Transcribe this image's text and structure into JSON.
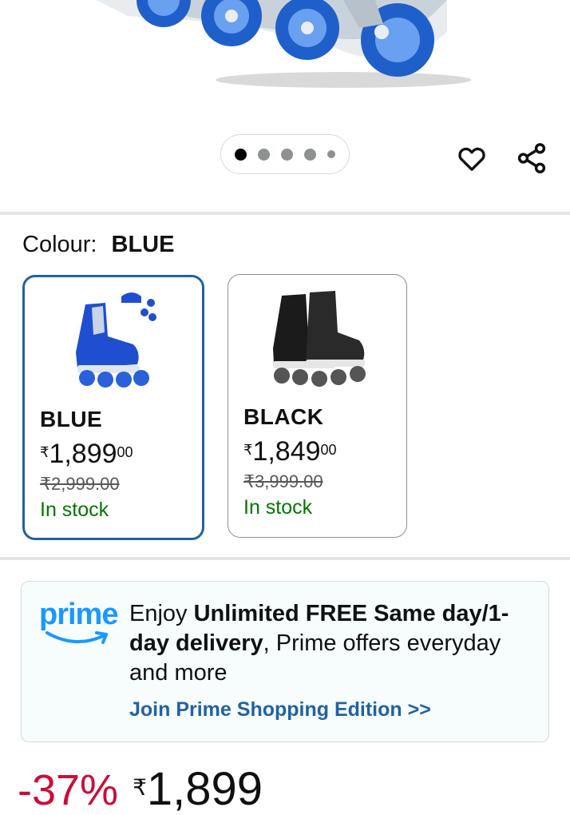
{
  "gallery": {
    "dot_count": 5,
    "active_index": 0
  },
  "icons": {
    "wishlist": "heart-outline-icon",
    "share": "share-icon"
  },
  "colour": {
    "label": "Colour:",
    "selected": "BLUE"
  },
  "variants": [
    {
      "name": "BLUE",
      "currency": "₹",
      "price_whole": "1,899",
      "price_fraction": "00",
      "mrp": "₹2,999.00",
      "stock": "In stock",
      "selected": true
    },
    {
      "name": "BLACK",
      "currency": "₹",
      "price_whole": "1,849",
      "price_fraction": "00",
      "mrp": "₹3,999.00",
      "stock": "In stock",
      "selected": false
    }
  ],
  "prime": {
    "logo_text": "prime",
    "text_prefix": "Enjoy ",
    "text_bold": "Unlimited FREE Same day/1-day delivery",
    "text_suffix": ", Prime offers everyday and more",
    "link": "Join Prime Shopping Edition >>"
  },
  "price": {
    "discount": "-37%",
    "currency": "₹",
    "amount": "1,899"
  },
  "colors": {
    "accent_blue": "#2162a1",
    "prime_blue": "#1a98ff",
    "stock_green": "#007600",
    "discount_red": "#cc0c39"
  }
}
